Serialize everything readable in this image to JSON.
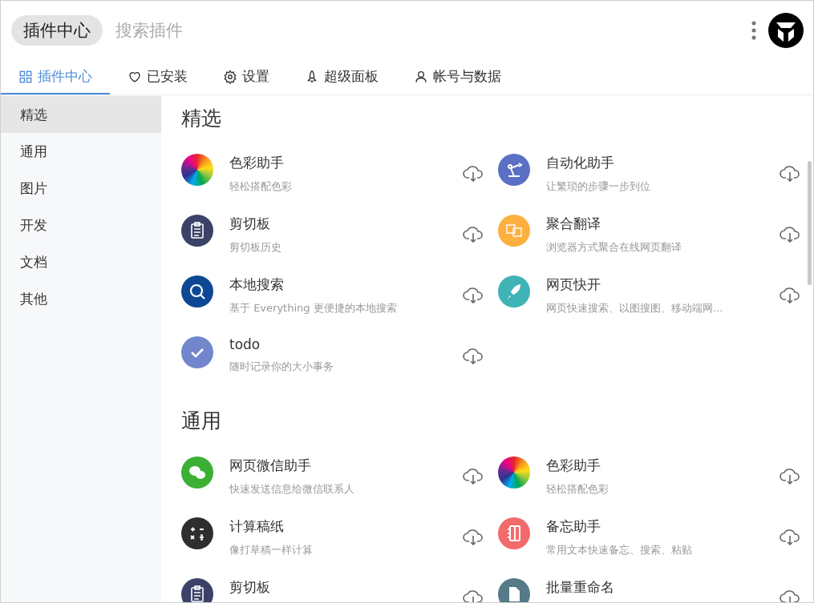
{
  "header": {
    "title": "插件中心",
    "search": {
      "placeholder": "搜索插件"
    }
  },
  "tabs": [
    {
      "label": "插件中心",
      "selected": true
    },
    {
      "label": "已安装",
      "selected": false
    },
    {
      "label": "设置",
      "selected": false
    },
    {
      "label": "超级面板",
      "selected": false
    },
    {
      "label": "帐号与数据",
      "selected": false
    }
  ],
  "sidebar": {
    "items": [
      {
        "label": "精选",
        "selected": true
      },
      {
        "label": "通用",
        "selected": false
      },
      {
        "label": "图片",
        "selected": false
      },
      {
        "label": "开发",
        "selected": false
      },
      {
        "label": "文档",
        "selected": false
      },
      {
        "label": "其他",
        "selected": false
      }
    ]
  },
  "sections": [
    {
      "title": "精选",
      "plugins": [
        {
          "name": "色彩助手",
          "description": "轻松搭配色彩",
          "kind": "wheel"
        },
        {
          "name": "自动化助手",
          "description": "让繁琐的步骤一步到位",
          "kind": "robot",
          "color": "#5b6fc4"
        },
        {
          "name": "剪切板",
          "description": "剪切板历史",
          "kind": "clipboard",
          "color": "#3a4268"
        },
        {
          "name": "聚合翻译",
          "description": "浏览器方式聚合在线网页翻译",
          "kind": "translate",
          "color": "#fbb040"
        },
        {
          "name": "本地搜索",
          "description": "基于 Everything 更便捷的本地搜索",
          "kind": "search",
          "color": "#0e4894"
        },
        {
          "name": "网页快开",
          "description": "网页快速搜索、以图搜图、移动端网...",
          "kind": "rocket",
          "color": "#3fb3b6"
        },
        {
          "name": "todo",
          "description": "随时记录你的大小事务",
          "kind": "check",
          "color": "#7286cc"
        }
      ]
    },
    {
      "title": "通用",
      "plugins": [
        {
          "name": "网页微信助手",
          "description": "快速发送信息给微信联系人",
          "kind": "chat",
          "color": "#3cb034"
        },
        {
          "name": "色彩助手",
          "description": "轻松搭配色彩",
          "kind": "wheel"
        },
        {
          "name": "计算稿纸",
          "description": "像打草稿一样计算",
          "kind": "calc",
          "color": "#2e2e2e"
        },
        {
          "name": "备忘助手",
          "description": "常用文本快速备忘、搜索、粘贴",
          "kind": "note",
          "color": "#f26a6a"
        },
        {
          "name": "剪切板",
          "kind": "clipboard",
          "color": "#3a4268"
        },
        {
          "name": "批量重命名",
          "kind": "rename",
          "color": "#557a88"
        }
      ]
    }
  ]
}
